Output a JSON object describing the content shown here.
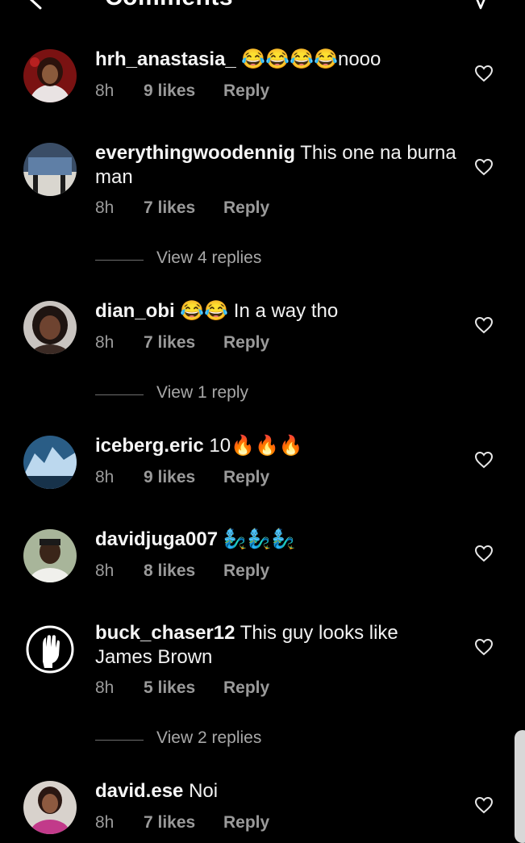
{
  "header": {
    "title": "Comments"
  },
  "comments": [
    {
      "username": "hrh_anastasia_",
      "text": " 😂😂😂😂nooo",
      "time": "8h",
      "likes": "9 likes",
      "reply": "Reply",
      "view_replies": ""
    },
    {
      "username": "everythingwoodennig",
      "text": " This one na burna man",
      "time": "8h",
      "likes": "7 likes",
      "reply": "Reply",
      "view_replies": "View 4 replies"
    },
    {
      "username": "dian_obi",
      "text": " 😂😂 In a way tho",
      "time": "8h",
      "likes": "7 likes",
      "reply": "Reply",
      "view_replies": "View 1 reply"
    },
    {
      "username": "iceberg.eric",
      "text": " 10🔥🔥🔥",
      "time": "8h",
      "likes": "9 likes",
      "reply": "Reply",
      "view_replies": ""
    },
    {
      "username": "davidjuga007",
      "text": " 🧞‍♂️🧞‍♂️🧞‍♂️",
      "time": "8h",
      "likes": "8 likes",
      "reply": "Reply",
      "view_replies": ""
    },
    {
      "username": "buck_chaser12",
      "text": " This guy looks like James Brown",
      "time": "8h",
      "likes": "5 likes",
      "reply": "Reply",
      "view_replies": "View 2 replies"
    },
    {
      "username": "david.ese",
      "text": " Noi",
      "time": "8h",
      "likes": "7 likes",
      "reply": "Reply",
      "view_replies": ""
    }
  ],
  "icons": {
    "back": "back-arrow-icon",
    "send": "send-icon",
    "like": "heart-icon"
  }
}
